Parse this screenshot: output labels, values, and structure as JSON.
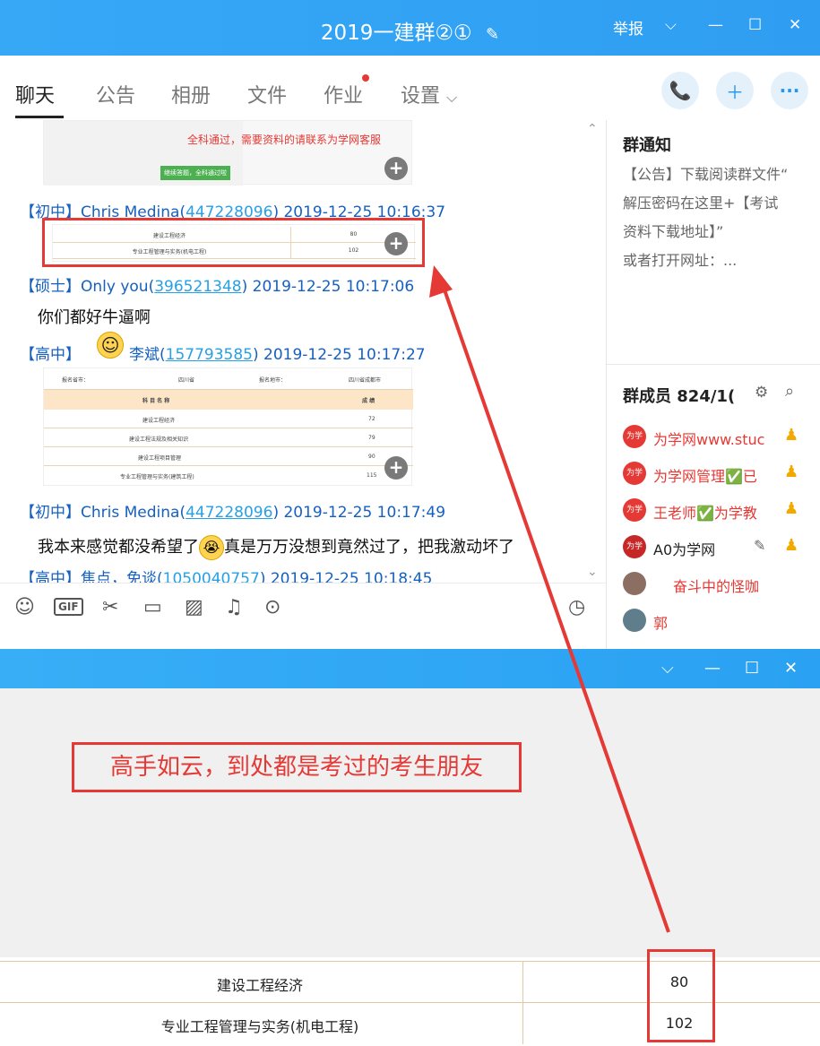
{
  "window": {
    "title": "2019一建群②①",
    "report_label": "举报"
  },
  "tabs": [
    {
      "label": "聊天"
    },
    {
      "label": "公告"
    },
    {
      "label": "相册"
    },
    {
      "label": "文件"
    },
    {
      "label": "作业"
    },
    {
      "label": "设置"
    }
  ],
  "chat": {
    "image1_caption": "全科通过，需要资料的请联系为学网客服",
    "image1_button": "继续答题，全科通过啦",
    "messages": [
      {
        "rank": "【初中】",
        "name": "Chris Medina",
        "qq": "447228096",
        "time": "2019-12-25 10:16:37"
      },
      {
        "rank": "【硕士】",
        "name": "Only you",
        "qq": "396521348",
        "time": "2019-12-25 10:17:06",
        "text": "你们都好牛逼啊"
      },
      {
        "rank": "【高中】",
        "name": "李斌",
        "qq": "157793585",
        "time": "2019-12-25 10:17:27"
      },
      {
        "rank": "【初中】",
        "name": "Chris Medina",
        "qq": "447228096",
        "time": "2019-12-25 10:17:49",
        "text": "我本来感觉都没希望了",
        "text_after": "真是万万没想到竟然过了，把我激动坏了"
      },
      {
        "rank": "【高中】",
        "name": "焦点，免谈",
        "qq": "1050040757",
        "time": "2019-12-25 10:18:45"
      }
    ],
    "thumb2_rows": [
      {
        "subject": "建设工程经济",
        "score": "80"
      },
      {
        "subject": "专业工程管理与实务(机电工程)",
        "score": "102"
      }
    ],
    "thumb3_header": [
      "报名省市：",
      "四川省",
      "报名地市：",
      "四川省成都市"
    ],
    "thumb3_cols": [
      "科 目 名 称",
      "成 绩"
    ],
    "thumb3_rows": [
      {
        "subject": "建设工程经济",
        "score": "72"
      },
      {
        "subject": "建设工程法规及相关知识",
        "score": "79"
      },
      {
        "subject": "建设工程项目管理",
        "score": "90"
      },
      {
        "subject": "专业工程管理与实务(建筑工程)",
        "score": "115"
      }
    ]
  },
  "right_panel": {
    "notice_title": "群通知",
    "notice_lines": [
      "【公告】下载阅读群文件“",
      "解压密码在这里+【考试",
      "资料下载地址】”",
      "或者打开网址：..."
    ],
    "members_title": "群成员 824/1(",
    "members": [
      {
        "name": "为学网www.stuc"
      },
      {
        "name": "为学网管理✅已"
      },
      {
        "name": "王老师✅为学教"
      },
      {
        "name": "A0为学网"
      },
      {
        "name": "奋斗中的怪咖"
      },
      {
        "name": "郭"
      }
    ]
  },
  "lower": {
    "caption": "高手如云，到处都是考过的考生朋友",
    "rows": [
      {
        "subject": "建设工程经济",
        "score": "80"
      },
      {
        "subject": "专业工程管理与实务(机电工程)",
        "score": "102"
      }
    ]
  },
  "colors": {
    "accent": "#2f9ef2",
    "highlight": "#e53935",
    "link": "#1560c0"
  }
}
